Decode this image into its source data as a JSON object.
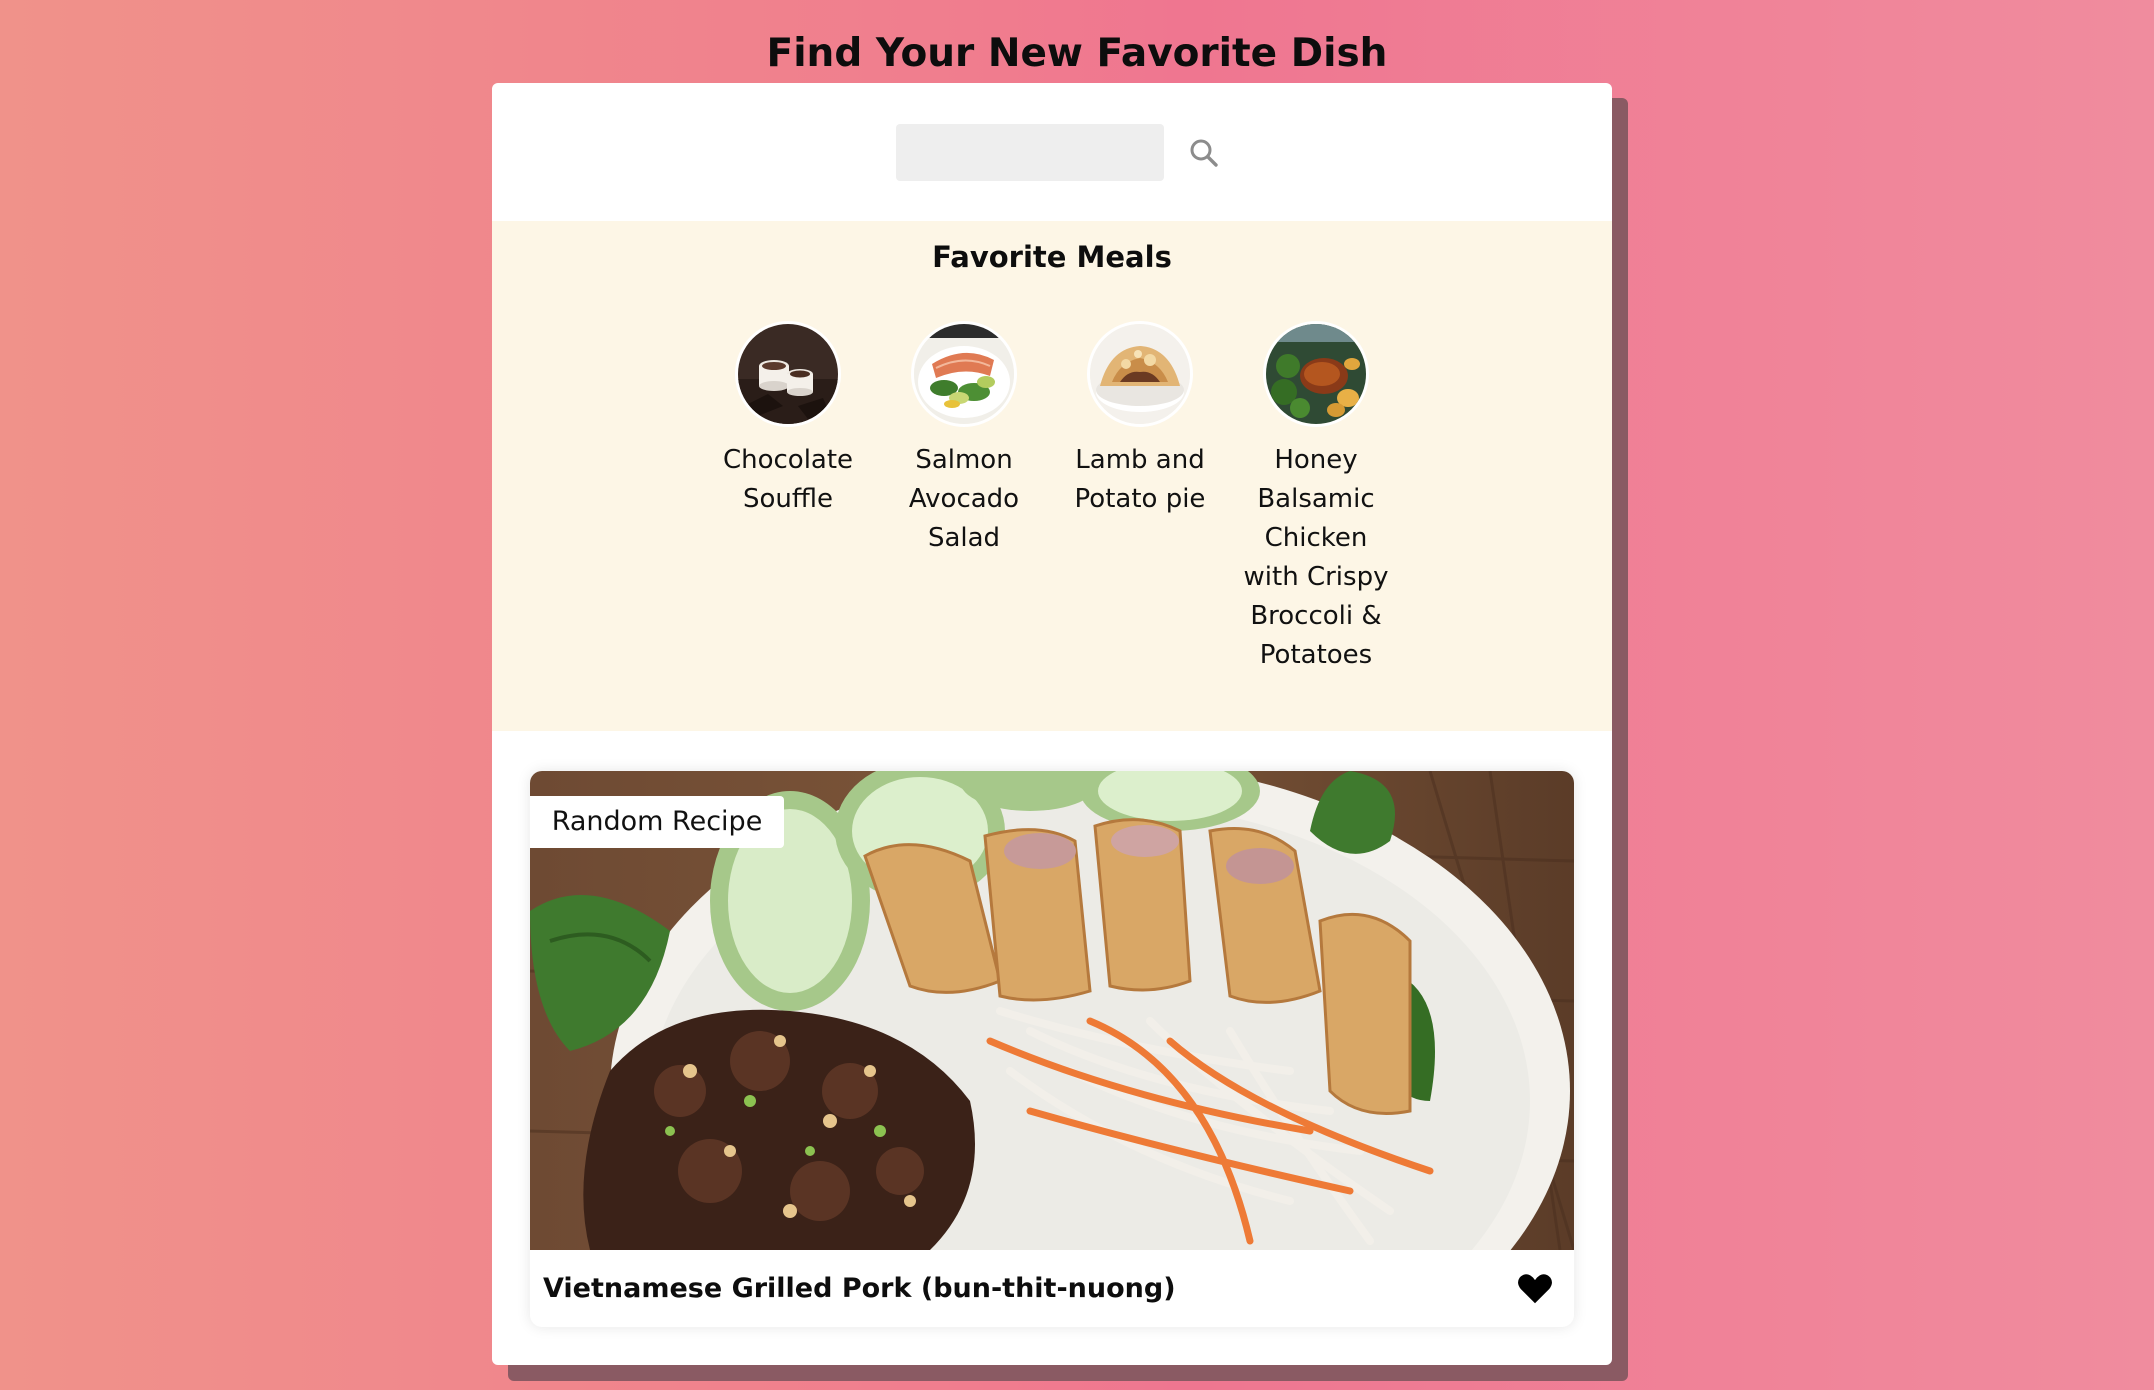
{
  "page": {
    "title": "Find Your New Favorite Dish"
  },
  "search": {
    "value": "",
    "placeholder": "",
    "icon": "search-icon"
  },
  "favorites": {
    "title": "Favorite Meals",
    "items": [
      {
        "name": "Chocolate Souffle"
      },
      {
        "name": "Salmon Avocado Salad"
      },
      {
        "name": "Lamb and Potato pie"
      },
      {
        "name": "Honey Balsamic Chicken with Crispy Broccoli & Potatoes"
      }
    ]
  },
  "random_meal": {
    "tag": "Random Recipe",
    "title": "Vietnamese Grilled Pork (bun-thit-nuong)",
    "favorite_icon": "heart-icon",
    "favorited": true
  },
  "colors": {
    "background_left": "#f0928a",
    "background_right": "#f08c9e",
    "favorites_background": "#fdf6e6",
    "card_shadow": "#8a5a63"
  }
}
